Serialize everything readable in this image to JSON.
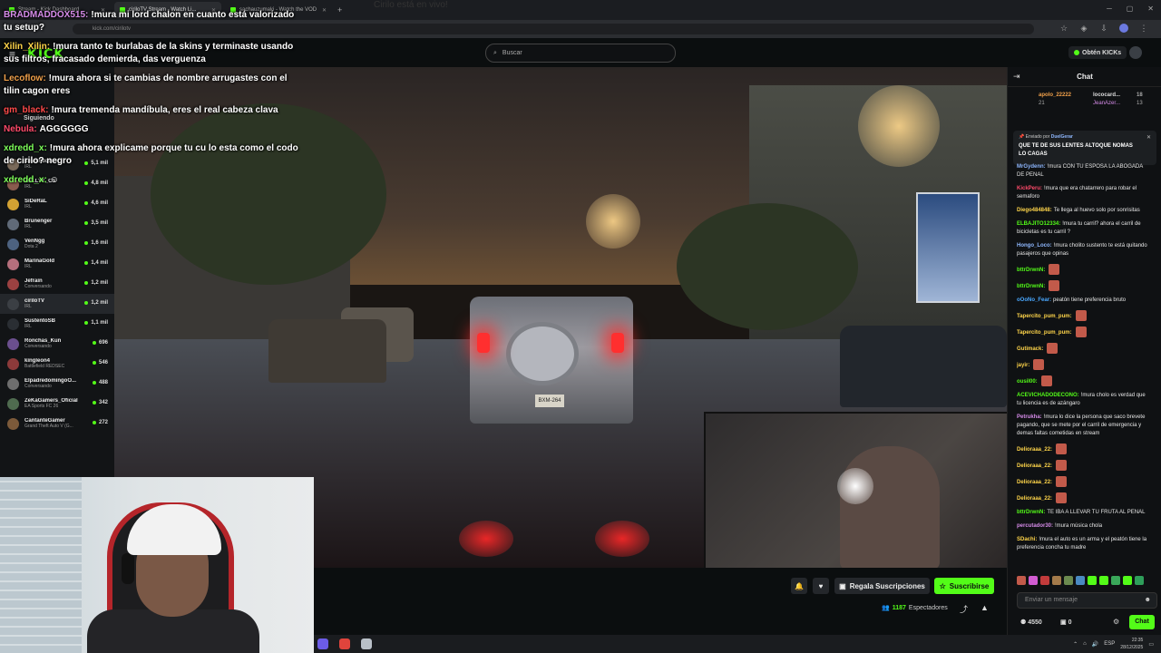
{
  "browser": {
    "tabs": [
      {
        "label": "Stream - Kick Dashboard",
        "active": false
      },
      {
        "label": "ciriloTV Stream - Watch Li...",
        "active": true
      },
      {
        "label": "sachauzumaki - Watch the VOD",
        "active": false
      }
    ],
    "new_tab": "+",
    "ghost_title": "Cirilo está en vivo!",
    "url": "kick.com/cirilotv"
  },
  "header": {
    "logo": "KICK",
    "search_placeholder": "Buscar",
    "kicks_button": "Obtén KICKs"
  },
  "sidebar": {
    "following_label": "Siguiendo",
    "channels": [
      {
        "name": "smashdota",
        "category": "IRL",
        "viewers": "5,1 mil",
        "color": "#7a6a5a"
      },
      {
        "name": "ZULLYY_CS",
        "category": "IRL",
        "viewers": "4,8 mil",
        "color": "#8a5c4e"
      },
      {
        "name": "SiDeRaL",
        "category": "IRL",
        "viewers": "4,6 mil",
        "color": "#d3a233"
      },
      {
        "name": "Brunenger",
        "category": "IRL",
        "viewers": "3,5 mil",
        "color": "#606a78"
      },
      {
        "name": "VenNgg",
        "category": "Dota 2",
        "viewers": "1,6 mil",
        "color": "#4d6280"
      },
      {
        "name": "MarinaGold",
        "category": "IRL",
        "viewers": "1,4 mil",
        "color": "#b56f7c"
      },
      {
        "name": "Jefrain",
        "category": "Conversando",
        "viewers": "1,2 mil",
        "color": "#9b4141"
      },
      {
        "name": "ciriloTV",
        "category": "IRL",
        "viewers": "1,2 mil",
        "color": "#3b3f44",
        "active": true
      },
      {
        "name": "SustentoSB",
        "category": "IRL",
        "viewers": "1,1 mil",
        "color": "#2a2e33"
      },
      {
        "name": "Ronchas_Kun",
        "category": "Conversando",
        "viewers": "696",
        "color": "#6b4f8e"
      },
      {
        "name": "kingleon4",
        "category": "Battlefield REDSEC",
        "viewers": "546",
        "color": "#8c3a3a"
      },
      {
        "name": "ElpadredomingoO...",
        "category": "Conversando",
        "viewers": "488",
        "color": "#6e6e6e"
      },
      {
        "name": "ZeKaGamers_Oficial",
        "category": "EA Sports FC 26",
        "viewers": "342",
        "color": "#4f6b4f"
      },
      {
        "name": "CantanteGamer",
        "category": "Grand Theft Auto V (G...",
        "viewers": "272",
        "color": "#7c5a3a"
      }
    ]
  },
  "overlay_chat": [
    {
      "user": "BRADMADDOX515:",
      "text": "!mura mi lord chalon en cuanto está valorizado tu setup?",
      "color": "#d58be8"
    },
    {
      "user": "Xilin_Xilin:",
      "text": "!mura tanto te burlabas de la skins y terminaste usando sus filtros, fracasado demierda, das verguenza",
      "color": "#ffd54a"
    },
    {
      "user": "Lecoflow:",
      "text": "!mura ahora si te cambias de nombre arrugastes con el tilin cagon eres",
      "color": "#f0a04a"
    },
    {
      "user": "gm_black:",
      "text": "!mura tremenda mandíbula, eres el real cabeza clava",
      "color": "#ff4a4a"
    },
    {
      "user": "Nebula:",
      "text": "AGGGGGG",
      "color": "#ff4a6a"
    },
    {
      "user": "xdredd_x:",
      "text": "!mura ahora explicame porque tu cu lo esta como el codo de cirilo? negro",
      "color": "#7dff5a"
    },
    {
      "user": "xdredd_x:",
      "text": "☺",
      "color": "#7dff5a"
    }
  ],
  "video": {
    "plate": "BXM-264",
    "webcam_tag": "inghouse"
  },
  "actions": {
    "gift_subs": "Regala Suscripciones",
    "subscribe": "Suscribirse",
    "viewers_count": "1187",
    "viewers_label": "Espectadores"
  },
  "chat": {
    "title": "Chat",
    "gifters": [
      {
        "name": "apolo_22222",
        "count": "21",
        "color": "#f0a04a"
      },
      {
        "name": "lococard...",
        "count": "18",
        "color": "#ddd"
      },
      {
        "name": "JeanAzer...",
        "count": "13",
        "color": "#d58be8"
      }
    ],
    "pinned_by_label": "Enviado por",
    "pinned_by": "DuelGerar",
    "pinned_message": "QUE TE DE SUS LENTES ALTOQUE NOMAS LO CAGAS",
    "messages": [
      {
        "user": "MrGydenn:",
        "text": "!mura CON TU ESPOSA LA ABOGADA DE PENAL",
        "color": "#8fb8ff"
      },
      {
        "user": "KickPeru:",
        "text": "!mura que era chatarrero para robar el semaforo",
        "color": "#ff4a6a"
      },
      {
        "user": "Diego484848:",
        "text": "Te llega al huevo solo por sonrisitas",
        "color": "#ffd54a"
      },
      {
        "user": "ELBAJITO12334:",
        "text": "!mura tu carril? ahora el carril de bicicletas es tu carril ?",
        "color": "#53fc18"
      },
      {
        "user": "Hongo_Loco:",
        "text": "!mura cholito sustento te está quitando pasajeros que opinas",
        "color": "#8fb8ff"
      },
      {
        "user": "bttrDrwnN:",
        "text": "",
        "color": "#53fc18",
        "emote": true
      },
      {
        "user": "bttrDrwnN:",
        "text": "",
        "color": "#53fc18",
        "emote": true
      },
      {
        "user": "oOoNo_Fear:",
        "text": "peatón tiene preferencia bruto",
        "color": "#4aa8ff"
      },
      {
        "user": "Tapercito_pum_pum:",
        "text": "",
        "color": "#ffd54a",
        "emote": true
      },
      {
        "user": "Tapercito_pum_pum:",
        "text": "",
        "color": "#ffd54a",
        "emote": true
      },
      {
        "user": "Gutimack:",
        "text": "",
        "color": "#ffd54a",
        "emote": true
      },
      {
        "user": "jayir:",
        "text": "",
        "color": "#ffd54a",
        "emote": true
      },
      {
        "user": "ousil00:",
        "text": "",
        "color": "#53fc18",
        "emote": true
      },
      {
        "user": "ACEVICHADODECONO:",
        "text": "!mura cholo es verdad que tu licencia es de azángaro",
        "color": "#53fc18"
      },
      {
        "user": "Petrukha:",
        "text": "!mura lo dice la persona que saco brevete pagando, que se mete por el carril de emergencia y demas faltas cometidas en stream",
        "color": "#d58be8"
      },
      {
        "user": "Delioraaa_22:",
        "text": "",
        "color": "#ffd54a",
        "emote": true
      },
      {
        "user": "Delioraaa_22:",
        "text": "",
        "color": "#ffd54a",
        "emote": true
      },
      {
        "user": "Delioraaa_22:",
        "text": "",
        "color": "#ffd54a",
        "emote": true
      },
      {
        "user": "Delioraaa_22:",
        "text": "",
        "color": "#ffd54a",
        "emote": true
      },
      {
        "user": "bttrDrwnN:",
        "text": "TE IBA A LLEVAR TU FRUTA AL PENAL",
        "color": "#53fc18"
      },
      {
        "user": "percutador30:",
        "text": "!mura música chola",
        "color": "#d58be8"
      },
      {
        "user": "SDachi:",
        "text": "!mura el auto es un arma y el peatón tiene la preferencia concha tu madre",
        "color": "#ffd54a"
      }
    ],
    "input_placeholder": "Enviar un mensaje",
    "points": "4550",
    "points2": "0",
    "send_label": "Chat"
  },
  "taskbar": {
    "language": "ESP",
    "time": "22:35",
    "date": "28/12/2025"
  }
}
